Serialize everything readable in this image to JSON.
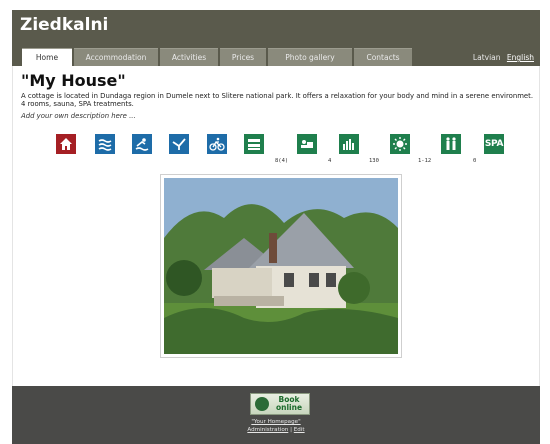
{
  "site": {
    "title": "Ziedkalni"
  },
  "nav": {
    "tabs": [
      {
        "label": "Home",
        "active": true
      },
      {
        "label": "Accommodation",
        "active": false
      },
      {
        "label": "Activities",
        "active": false
      },
      {
        "label": "Prices",
        "active": false
      },
      {
        "label": "Photo gallery",
        "active": false
      },
      {
        "label": "Contacts",
        "active": false
      }
    ],
    "languages": [
      "Latvian",
      "English"
    ]
  },
  "main": {
    "title": "\"My House\"",
    "description": "A cottage is located in Dundaga region in Dumele next to Slitere national park. It offers a relaxation for your body and mind in a serene environmet. 4 rooms, sauna, SPA treatments.",
    "add_description": "Add your own description here ...",
    "facilities": [
      {
        "icon": "house-icon",
        "count": ""
      },
      {
        "icon": "water-icon",
        "count": ""
      },
      {
        "icon": "swimming-icon",
        "count": ""
      },
      {
        "icon": "bird-icon",
        "count": ""
      },
      {
        "icon": "bicycle-icon",
        "count": ""
      },
      {
        "icon": "beds-icon",
        "count": "8(4)"
      },
      {
        "icon": "single-bed-icon",
        "count": "4"
      },
      {
        "icon": "people-icon",
        "count": "130"
      },
      {
        "icon": "sun-icon",
        "count": "1-12"
      },
      {
        "icon": "family-icon",
        "count": "0"
      },
      {
        "icon": "spa-icon",
        "count": ""
      }
    ],
    "spa_label": "SPA"
  },
  "footer": {
    "book_line1": "Book",
    "book_line2": "online",
    "homepage_link": "\"Your Homepage\"",
    "admin_link": "Administration",
    "separator": "|",
    "edit_link": "Edit"
  },
  "colors": {
    "header_bg": "#5a5a4c",
    "footer_bg": "#4a4a48",
    "icon_green": "#1f7f4d",
    "icon_red": "#a51f24",
    "icon_blue": "#1e6ca8"
  }
}
